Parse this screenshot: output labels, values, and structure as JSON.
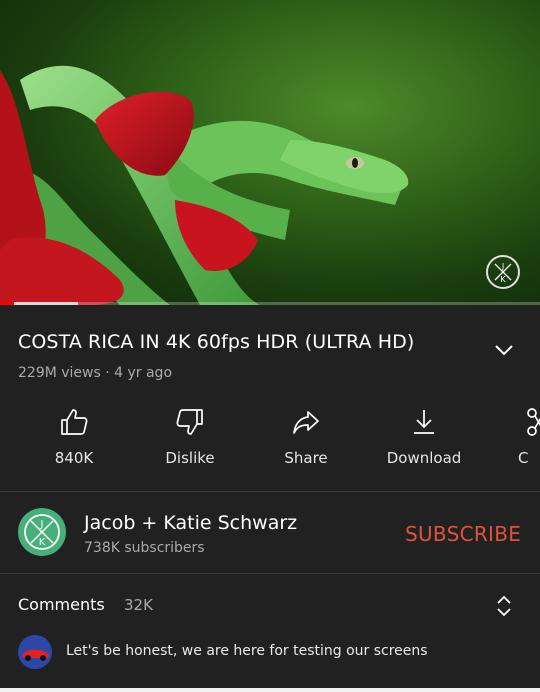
{
  "video": {
    "watermark_letters": [
      "J",
      "K"
    ],
    "progress_fraction": 0.145
  },
  "details": {
    "title": "COSTA RICA IN 4K 60fps HDR (ULTRA HD)",
    "meta": "229M views · 4 yr ago"
  },
  "actions": [
    {
      "label": "840K",
      "icon": "thumbs-up-icon"
    },
    {
      "label": "Dislike",
      "icon": "thumbs-down-icon"
    },
    {
      "label": "Share",
      "icon": "share-icon"
    },
    {
      "label": "Download",
      "icon": "download-icon"
    },
    {
      "label": "C",
      "icon": "clip-icon"
    }
  ],
  "channel": {
    "name": "Jacob + Katie Schwarz",
    "subscribers": "738K subscribers",
    "subscribe_label": "SUBSCRIBE",
    "subscribe_color": "#e0533a"
  },
  "comments": {
    "title": "Comments",
    "count": "32K",
    "top_comment": "Let's be honest, we are here for testing our screens"
  }
}
